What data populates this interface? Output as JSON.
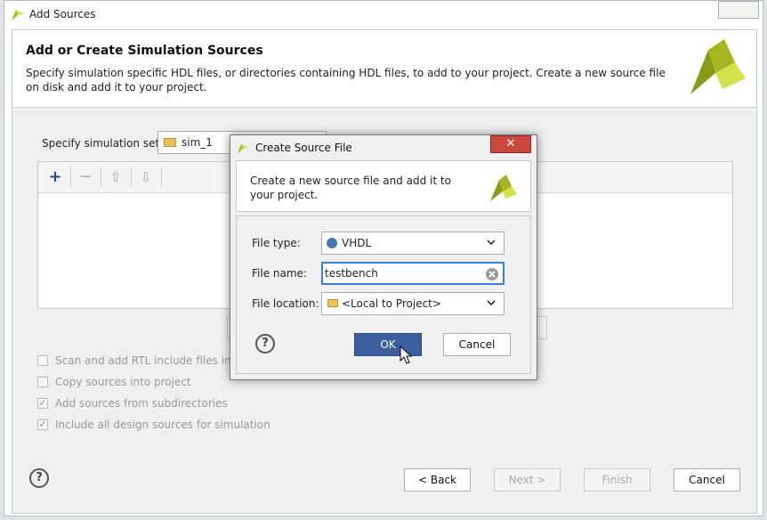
{
  "window": {
    "title": "Add Sources"
  },
  "header": {
    "title": "Add or Create Simulation Sources",
    "description": "Specify simulation specific HDL files, or directories containing HDL files, to add to your project. Create a new source file on disk and add it to your project."
  },
  "simulation_set": {
    "label": "Specify simulation set:",
    "value": "sim_1"
  },
  "toolbar": {
    "add": "+",
    "remove": "−",
    "up": "⇧",
    "down": "⇩"
  },
  "options": [
    {
      "label": "Scan and add RTL include files into",
      "checked": false
    },
    {
      "label": "Copy sources into project",
      "checked": false
    },
    {
      "label": "Add sources from subdirectories",
      "checked": true
    },
    {
      "label": "Include all design sources for simulation",
      "checked": true
    }
  ],
  "footer": {
    "help": "?",
    "back": "< Back",
    "next": "Next >",
    "finish": "Finish",
    "cancel": "Cancel"
  },
  "dialog": {
    "title": "Create Source File",
    "close": "✕",
    "description": "Create a new source file and add it to your project.",
    "file_type_label": "File type:",
    "file_type_value": "VHDL",
    "file_name_label": "File name:",
    "file_name_value": "testbench",
    "file_location_label": "File location:",
    "file_location_value": "<Local to Project>",
    "help": "?",
    "ok": "OK",
    "cancel": "Cancel"
  },
  "colors": {
    "accent": "#3c5fa0",
    "logo_green": "#a6b520",
    "logo_light": "#d6e04a"
  }
}
